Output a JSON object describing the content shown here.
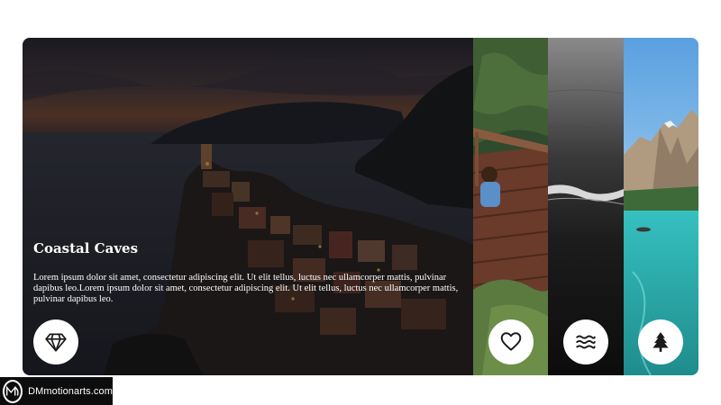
{
  "panels": [
    {
      "id": "coastal",
      "title": "Coastal Caves",
      "description": "Lorem ipsum dolor sit amet, consectetur adipiscing elit. Ut elit tellus, luctus nec ullamcorper mattis, pulvinar dapibus leo.Lorem ipsum dolor sit amet, consectetur adipiscing elit. Ut elit tellus, luctus nec ullamcorper mattis, pulvinar dapibus leo.",
      "icon": "diamond-icon"
    },
    {
      "id": "deck",
      "icon": "heart-icon"
    },
    {
      "id": "ocean",
      "icon": "waves-icon"
    },
    {
      "id": "mountain",
      "icon": "tree-icon"
    }
  ],
  "brand": {
    "label": "DMmotionarts.com",
    "icon": "dm-logo-icon"
  },
  "colors": {
    "overlay": "#000000",
    "icon_bg": "#ffffff",
    "icon_stroke": "#1a1a1a"
  }
}
